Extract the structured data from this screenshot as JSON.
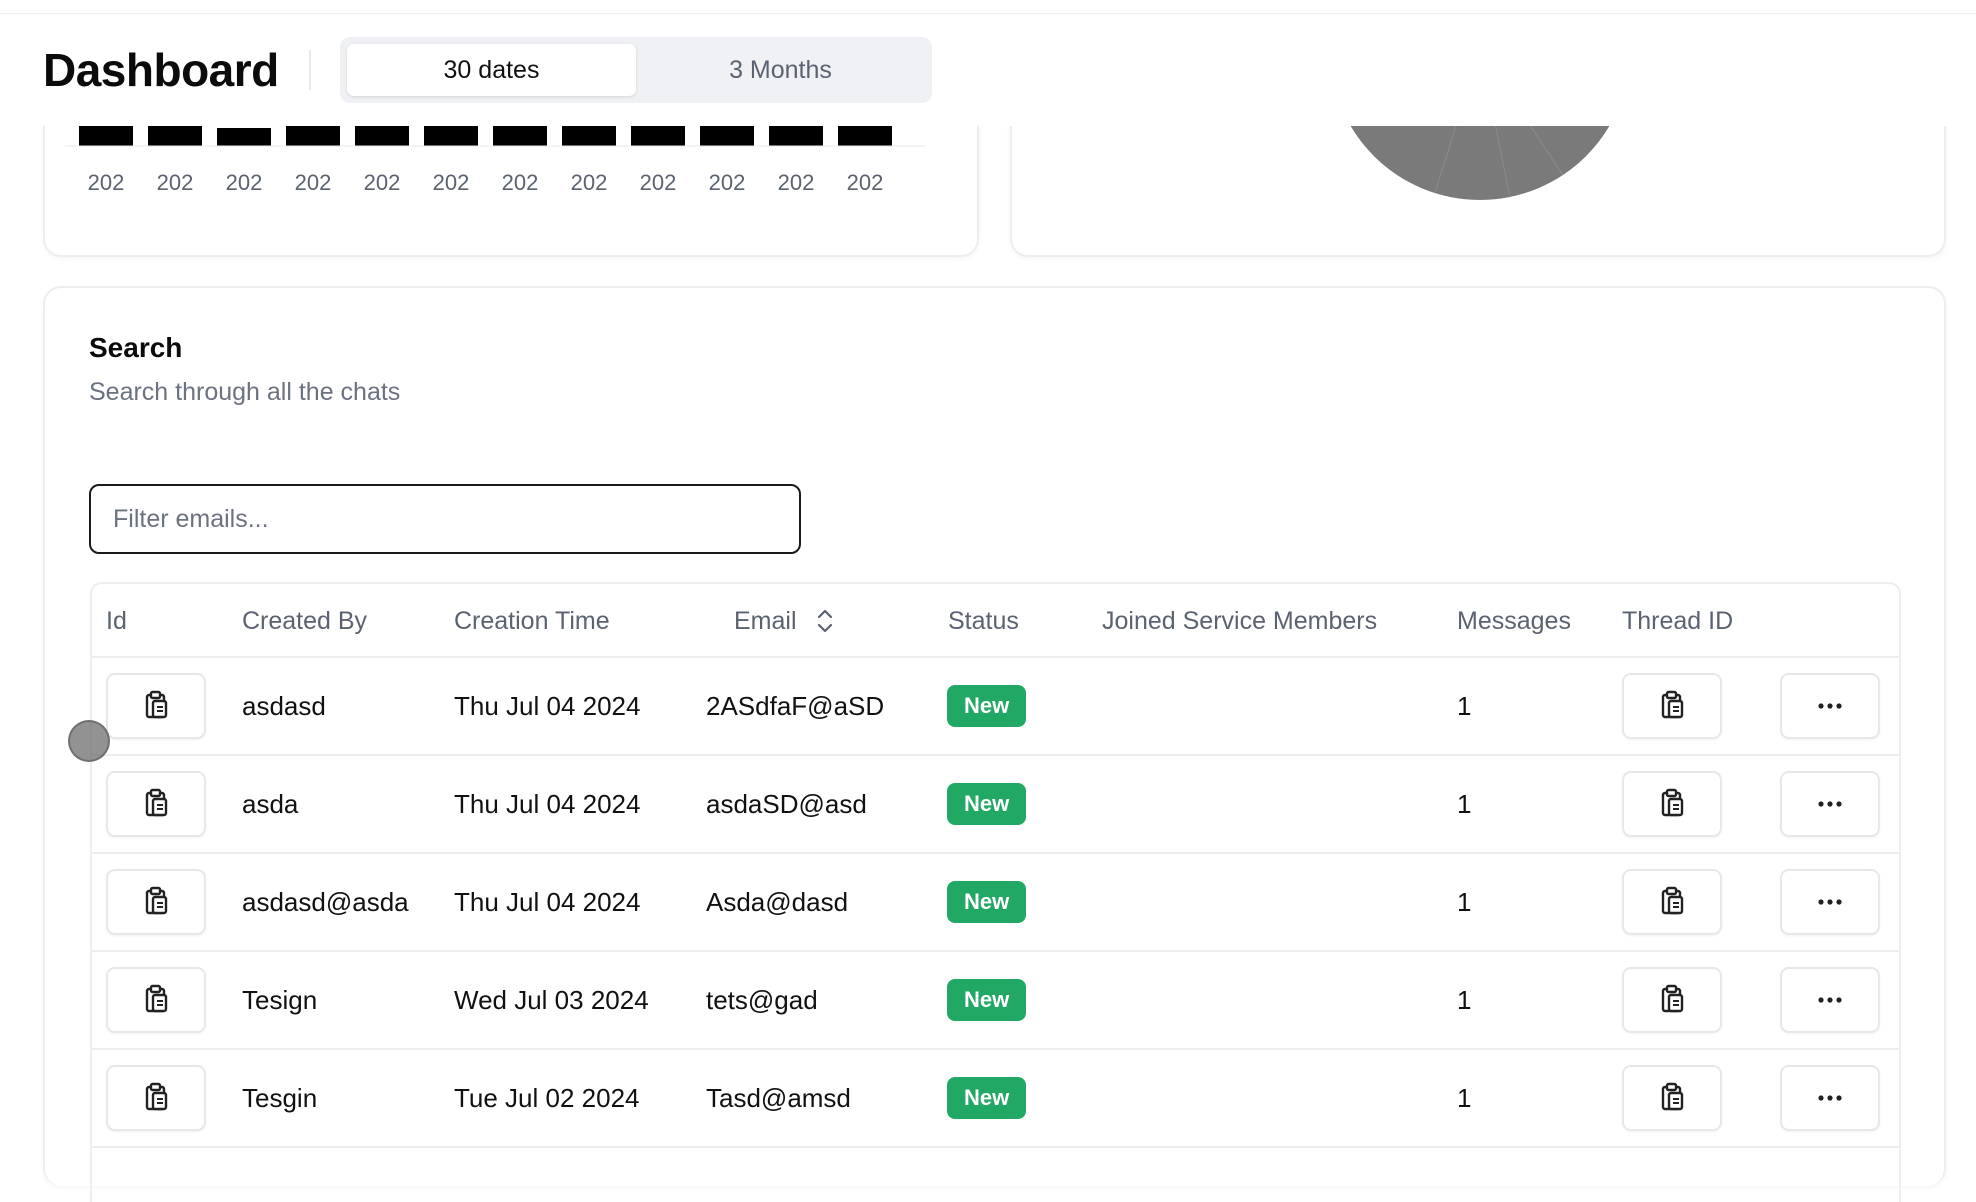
{
  "header": {
    "title": "Dashboard",
    "tabs": [
      {
        "label": "30 dates",
        "active": true
      },
      {
        "label": "3 Months",
        "active": false
      }
    ]
  },
  "bar_chart": {
    "tick_labels": [
      "202",
      "202",
      "202",
      "202",
      "202",
      "202",
      "202",
      "202",
      "202",
      "202",
      "202",
      "202"
    ],
    "bar_color": "#000000"
  },
  "pie_chart": {
    "color": "#7a7a7a"
  },
  "search": {
    "title": "Search",
    "subtitle": "Search through all the chats",
    "filter_placeholder": "Filter emails...",
    "filter_value": ""
  },
  "table": {
    "columns": {
      "id": "Id",
      "created_by": "Created By",
      "creation_time": "Creation Time",
      "email": "Email",
      "status": "Status",
      "joined": "Joined Service Members",
      "messages": "Messages",
      "thread_id": "Thread ID"
    },
    "sort_icon": "chevrons-up-down-icon",
    "copy_icon": "clipboard-copy-icon",
    "more_icon": "ellipsis-icon",
    "status_color": "#22a865",
    "rows": [
      {
        "created_by": "asdasd",
        "creation_time": "Thu Jul 04 2024",
        "email": "2ASdfaF@aSD",
        "status": "New",
        "joined": "",
        "messages": "1"
      },
      {
        "created_by": "asda",
        "creation_time": "Thu Jul 04 2024",
        "email": "asdaSD@asd",
        "status": "New",
        "joined": "",
        "messages": "1"
      },
      {
        "created_by": "asdasd@asda",
        "creation_time": "Thu Jul 04 2024",
        "email": "Asda@dasd",
        "status": "New",
        "joined": "",
        "messages": "1"
      },
      {
        "created_by": "Tesign",
        "creation_time": "Wed Jul 03 2024",
        "email": "tets@gad",
        "status": "New",
        "joined": "",
        "messages": "1"
      },
      {
        "created_by": "Tesgin",
        "creation_time": "Tue Jul 02 2024",
        "email": "Tasd@amsd",
        "status": "New",
        "joined": "",
        "messages": "1"
      }
    ]
  }
}
